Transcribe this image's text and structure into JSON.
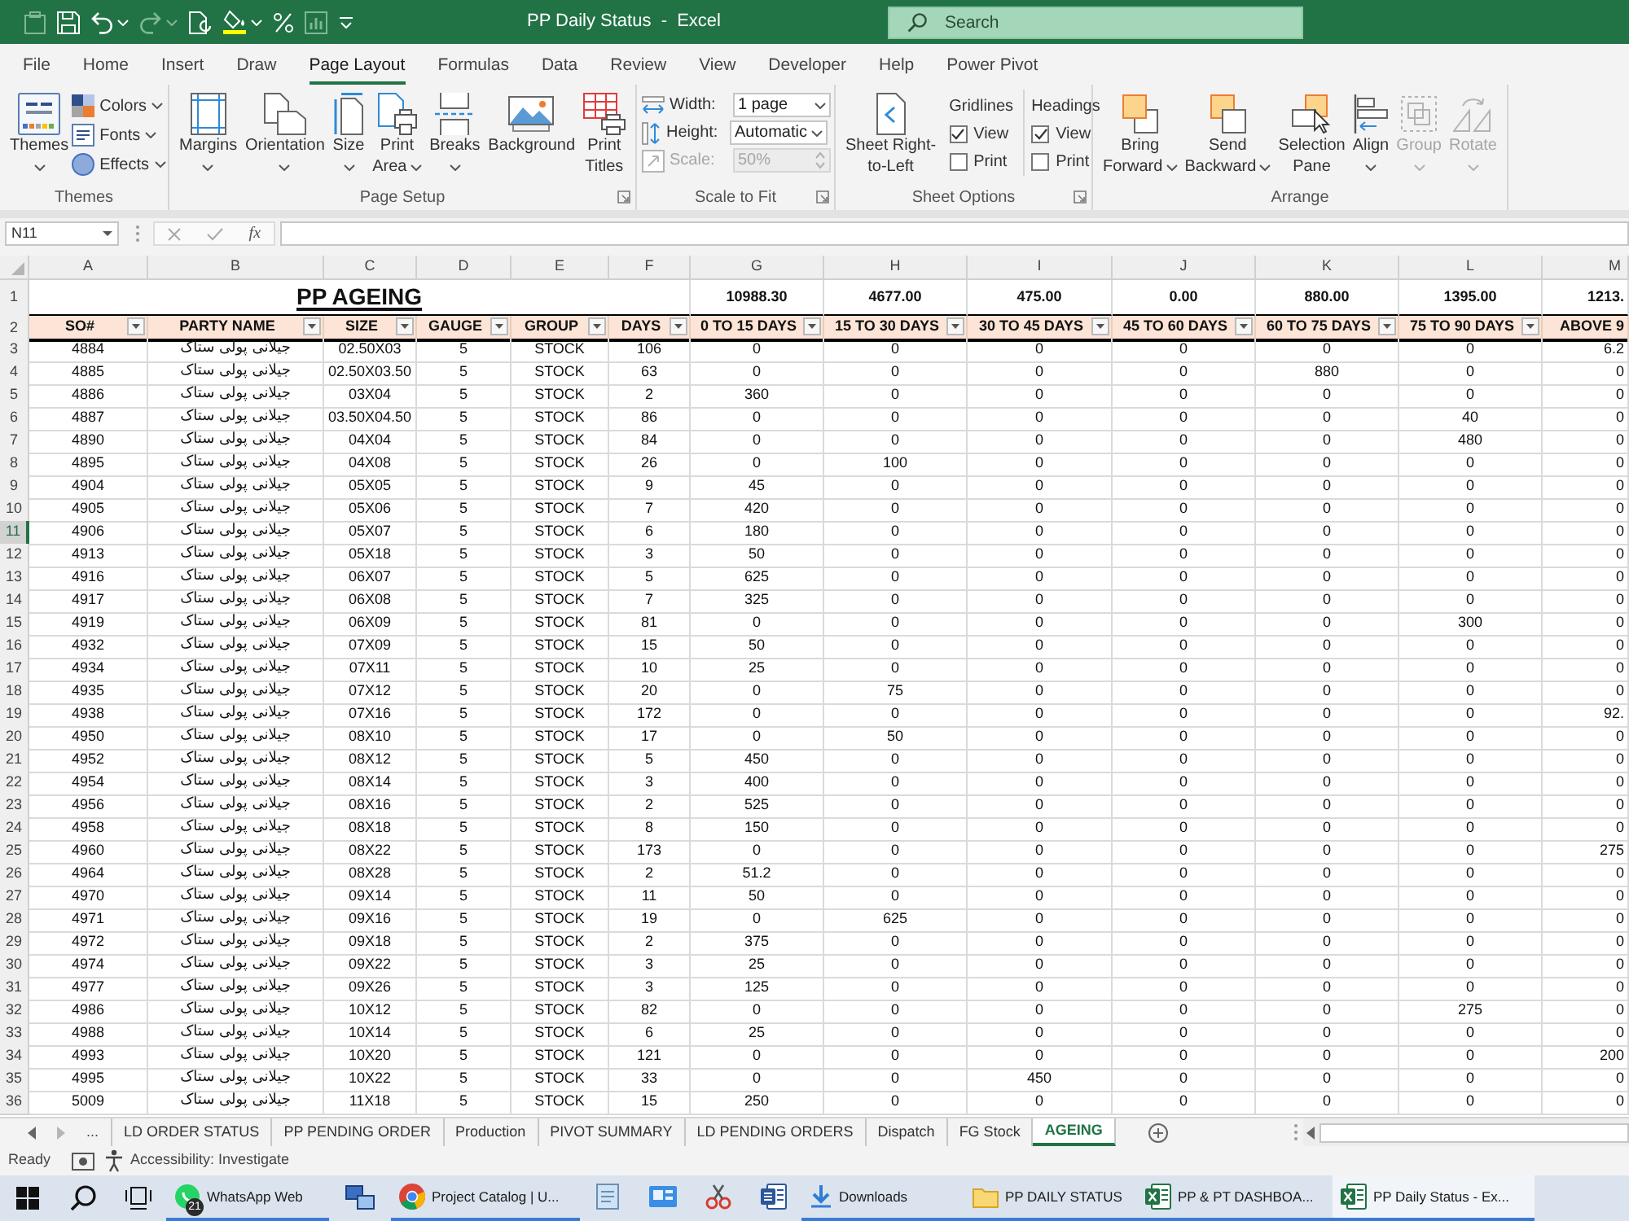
{
  "title_bar": {
    "title": "PP Daily Status  -  Excel",
    "search_placeholder": "Search",
    "quick_access": [
      {
        "disabled": true,
        "menu": false
      },
      {
        "disabled": false,
        "menu": false
      },
      {
        "disabled": false,
        "menu": true
      },
      {
        "disabled": true,
        "menu": true
      },
      {
        "disabled": false,
        "menu": false
      },
      {
        "disabled": false,
        "menu": true
      },
      {
        "disabled": false,
        "menu": false
      },
      {
        "disabled": true,
        "menu": false
      },
      {
        "disabled": false,
        "menu": false
      }
    ]
  },
  "ribbon_tabs": [
    {
      "label": "File",
      "selected": false
    },
    {
      "label": "Home",
      "selected": false
    },
    {
      "label": "Insert",
      "selected": false
    },
    {
      "label": "Draw",
      "selected": false
    },
    {
      "label": "Page Layout",
      "selected": true
    },
    {
      "label": "Formulas",
      "selected": false
    },
    {
      "label": "Data",
      "selected": false
    },
    {
      "label": "Review",
      "selected": false
    },
    {
      "label": "View",
      "selected": false
    },
    {
      "label": "Developer",
      "selected": false
    },
    {
      "label": "Help",
      "selected": false
    },
    {
      "label": "Power Pivot",
      "selected": false
    }
  ],
  "ribbon": {
    "groups": [
      {
        "label": "Themes",
        "launcher": false,
        "items": [
          {
            "kind": "large",
            "lines": [
              "Themes"
            ],
            "menu": true,
            "disabled": false
          },
          {
            "kind": "small",
            "label": "Colors",
            "menu": true,
            "disabled": false
          },
          {
            "kind": "small",
            "label": "Fonts",
            "menu": true,
            "disabled": false
          },
          {
            "kind": "small",
            "label": "Effects",
            "menu": true,
            "disabled": false
          }
        ]
      },
      {
        "label": "Page Setup",
        "launcher": true,
        "items": [
          {
            "kind": "large",
            "lines": [
              "Margins"
            ],
            "menu": true,
            "disabled": false
          },
          {
            "kind": "large",
            "lines": [
              "Orientation"
            ],
            "menu": true,
            "disabled": false
          },
          {
            "kind": "large",
            "lines": [
              "Size"
            ],
            "menu": true,
            "disabled": false
          },
          {
            "kind": "large",
            "lines": [
              "Print",
              "Area"
            ],
            "menu": true,
            "disabled": false
          },
          {
            "kind": "large",
            "lines": [
              "Breaks"
            ],
            "menu": true,
            "disabled": false
          },
          {
            "kind": "large",
            "lines": [
              "Background"
            ],
            "menu": false,
            "disabled": false
          },
          {
            "kind": "large",
            "lines": [
              "Print",
              "Titles"
            ],
            "menu": false,
            "disabled": false
          }
        ]
      },
      {
        "label": "Scale to Fit",
        "launcher": true,
        "items": [
          {
            "kind": "dropdown",
            "label": "Width:",
            "value": "1 page",
            "disabled": false
          },
          {
            "kind": "dropdown",
            "label": "Height:",
            "value": "Automatic",
            "disabled": false
          },
          {
            "kind": "spinner",
            "label": "Scale:",
            "value": "50%",
            "disabled": true
          }
        ]
      },
      {
        "label": "Sheet Options",
        "launcher": true,
        "items": [
          {
            "kind": "large",
            "lines": [
              "Sheet Right-",
              "to-Left"
            ],
            "menu": false,
            "disabled": false
          },
          {
            "kind": "checks",
            "heading": "Gridlines",
            "options": [
              {
                "label": "View",
                "checked": true
              },
              {
                "label": "Print",
                "checked": false
              }
            ]
          },
          {
            "kind": "checks",
            "heading": "Headings",
            "options": [
              {
                "label": "View",
                "checked": true
              },
              {
                "label": "Print",
                "checked": false
              }
            ]
          }
        ]
      },
      {
        "label": "Arrange",
        "launcher": false,
        "items": [
          {
            "kind": "large",
            "lines": [
              "Bring",
              "Forward"
            ],
            "menu": true,
            "disabled": false
          },
          {
            "kind": "large",
            "lines": [
              "Send",
              "Backward"
            ],
            "menu": true,
            "disabled": false
          },
          {
            "kind": "large",
            "lines": [
              "Selection",
              "Pane"
            ],
            "menu": false,
            "disabled": false
          },
          {
            "kind": "large",
            "lines": [
              "Align"
            ],
            "menu": true,
            "disabled": false
          },
          {
            "kind": "large",
            "lines": [
              "Group"
            ],
            "menu": true,
            "disabled": true
          },
          {
            "kind": "large",
            "lines": [
              "Rotate"
            ],
            "menu": true,
            "disabled": true
          }
        ]
      }
    ]
  },
  "formula_bar": {
    "name_box": "N11",
    "function_label": "fx"
  },
  "sheet": {
    "columns": [
      {
        "letter": "A",
        "header": "SO#",
        "filter": true
      },
      {
        "letter": "B",
        "header": "PARTY NAME",
        "filter": true
      },
      {
        "letter": "C",
        "header": "SIZE",
        "filter": true
      },
      {
        "letter": "D",
        "header": "GAUGE",
        "filter": true
      },
      {
        "letter": "E",
        "header": "GROUP",
        "filter": true
      },
      {
        "letter": "F",
        "header": "DAYS",
        "filter": true
      },
      {
        "letter": "G",
        "header": "0 TO 15 DAYS",
        "filter": true
      },
      {
        "letter": "H",
        "header": "15 TO 30 DAYS",
        "filter": true
      },
      {
        "letter": "I",
        "header": "30 TO 45 DAYS",
        "filter": true
      },
      {
        "letter": "J",
        "header": "45 TO 60 DAYS",
        "filter": true
      },
      {
        "letter": "K",
        "header": "60 TO 75 DAYS",
        "filter": true
      },
      {
        "letter": "L",
        "header": "75 TO 90 DAYS",
        "filter": true
      },
      {
        "letter": "M",
        "header": "ABOVE 9",
        "filter": false
      }
    ],
    "title_row": {
      "number": "1",
      "title": "PP AGEING",
      "totals": [
        "10988.30",
        "4677.00",
        "475.00",
        "0.00",
        "880.00",
        "1395.00",
        "1213."
      ]
    },
    "header_row": {
      "number": "2"
    },
    "rows": [
      {
        "number": "3",
        "selected": false,
        "cells": [
          "4884",
          "جیلانی پولی ستاک",
          "02.50X03",
          "5",
          "STOCK",
          "106",
          "0",
          "0",
          "0",
          "0",
          "0",
          "0",
          "6.2"
        ]
      },
      {
        "number": "4",
        "selected": false,
        "cells": [
          "4885",
          "جیلانی پولی ستاک",
          "02.50X03.50",
          "5",
          "STOCK",
          "63",
          "0",
          "0",
          "0",
          "0",
          "880",
          "0",
          "0"
        ]
      },
      {
        "number": "5",
        "selected": false,
        "cells": [
          "4886",
          "جیلانی پولی ستاک",
          "03X04",
          "5",
          "STOCK",
          "2",
          "360",
          "0",
          "0",
          "0",
          "0",
          "0",
          "0"
        ]
      },
      {
        "number": "6",
        "selected": false,
        "cells": [
          "4887",
          "جیلانی پولی ستاک",
          "03.50X04.50",
          "5",
          "STOCK",
          "86",
          "0",
          "0",
          "0",
          "0",
          "0",
          "40",
          "0"
        ]
      },
      {
        "number": "7",
        "selected": false,
        "cells": [
          "4890",
          "جیلانی پولی ستاک",
          "04X04",
          "5",
          "STOCK",
          "84",
          "0",
          "0",
          "0",
          "0",
          "0",
          "480",
          "0"
        ]
      },
      {
        "number": "8",
        "selected": false,
        "cells": [
          "4895",
          "جیلانی پولی ستاک",
          "04X08",
          "5",
          "STOCK",
          "26",
          "0",
          "100",
          "0",
          "0",
          "0",
          "0",
          "0"
        ]
      },
      {
        "number": "9",
        "selected": false,
        "cells": [
          "4904",
          "جیلانی پولی ستاک",
          "05X05",
          "5",
          "STOCK",
          "9",
          "45",
          "0",
          "0",
          "0",
          "0",
          "0",
          "0"
        ]
      },
      {
        "number": "10",
        "selected": false,
        "cells": [
          "4905",
          "جیلانی پولی ستاک",
          "05X06",
          "5",
          "STOCK",
          "7",
          "420",
          "0",
          "0",
          "0",
          "0",
          "0",
          "0"
        ]
      },
      {
        "number": "11",
        "selected": true,
        "cells": [
          "4906",
          "جیلانی پولی ستاک",
          "05X07",
          "5",
          "STOCK",
          "6",
          "180",
          "0",
          "0",
          "0",
          "0",
          "0",
          "0"
        ]
      },
      {
        "number": "12",
        "selected": false,
        "cells": [
          "4913",
          "جیلانی پولی ستاک",
          "05X18",
          "5",
          "STOCK",
          "3",
          "50",
          "0",
          "0",
          "0",
          "0",
          "0",
          "0"
        ]
      },
      {
        "number": "13",
        "selected": false,
        "cells": [
          "4916",
          "جیلانی پولی ستاک",
          "06X07",
          "5",
          "STOCK",
          "5",
          "625",
          "0",
          "0",
          "0",
          "0",
          "0",
          "0"
        ]
      },
      {
        "number": "14",
        "selected": false,
        "cells": [
          "4917",
          "جیلانی پولی ستاک",
          "06X08",
          "5",
          "STOCK",
          "7",
          "325",
          "0",
          "0",
          "0",
          "0",
          "0",
          "0"
        ]
      },
      {
        "number": "15",
        "selected": false,
        "cells": [
          "4919",
          "جیلانی پولی ستاک",
          "06X09",
          "5",
          "STOCK",
          "81",
          "0",
          "0",
          "0",
          "0",
          "0",
          "300",
          "0"
        ]
      },
      {
        "number": "16",
        "selected": false,
        "cells": [
          "4932",
          "جیلانی پولی ستاک",
          "07X09",
          "5",
          "STOCK",
          "15",
          "50",
          "0",
          "0",
          "0",
          "0",
          "0",
          "0"
        ]
      },
      {
        "number": "17",
        "selected": false,
        "cells": [
          "4934",
          "جیلانی پولی ستاک",
          "07X11",
          "5",
          "STOCK",
          "10",
          "25",
          "0",
          "0",
          "0",
          "0",
          "0",
          "0"
        ]
      },
      {
        "number": "18",
        "selected": false,
        "cells": [
          "4935",
          "جیلانی پولی ستاک",
          "07X12",
          "5",
          "STOCK",
          "20",
          "0",
          "75",
          "0",
          "0",
          "0",
          "0",
          "0"
        ]
      },
      {
        "number": "19",
        "selected": false,
        "cells": [
          "4938",
          "جیلانی پولی ستاک",
          "07X16",
          "5",
          "STOCK",
          "172",
          "0",
          "0",
          "0",
          "0",
          "0",
          "0",
          "92."
        ]
      },
      {
        "number": "20",
        "selected": false,
        "cells": [
          "4950",
          "جیلانی پولی ستاک",
          "08X10",
          "5",
          "STOCK",
          "17",
          "0",
          "50",
          "0",
          "0",
          "0",
          "0",
          "0"
        ]
      },
      {
        "number": "21",
        "selected": false,
        "cells": [
          "4952",
          "جیلانی پولی ستاک",
          "08X12",
          "5",
          "STOCK",
          "5",
          "450",
          "0",
          "0",
          "0",
          "0",
          "0",
          "0"
        ]
      },
      {
        "number": "22",
        "selected": false,
        "cells": [
          "4954",
          "جیلانی پولی ستاک",
          "08X14",
          "5",
          "STOCK",
          "3",
          "400",
          "0",
          "0",
          "0",
          "0",
          "0",
          "0"
        ]
      },
      {
        "number": "23",
        "selected": false,
        "cells": [
          "4956",
          "جیلانی پولی ستاک",
          "08X16",
          "5",
          "STOCK",
          "2",
          "525",
          "0",
          "0",
          "0",
          "0",
          "0",
          "0"
        ]
      },
      {
        "number": "24",
        "selected": false,
        "cells": [
          "4958",
          "جیلانی پولی ستاک",
          "08X18",
          "5",
          "STOCK",
          "8",
          "150",
          "0",
          "0",
          "0",
          "0",
          "0",
          "0"
        ]
      },
      {
        "number": "25",
        "selected": false,
        "cells": [
          "4960",
          "جیلانی پولی ستاک",
          "08X22",
          "5",
          "STOCK",
          "173",
          "0",
          "0",
          "0",
          "0",
          "0",
          "0",
          "275"
        ]
      },
      {
        "number": "26",
        "selected": false,
        "cells": [
          "4964",
          "جیلانی پولی ستاک",
          "08X28",
          "5",
          "STOCK",
          "2",
          "51.2",
          "0",
          "0",
          "0",
          "0",
          "0",
          "0"
        ]
      },
      {
        "number": "27",
        "selected": false,
        "cells": [
          "4970",
          "جیلانی پولی ستاک",
          "09X14",
          "5",
          "STOCK",
          "11",
          "50",
          "0",
          "0",
          "0",
          "0",
          "0",
          "0"
        ]
      },
      {
        "number": "28",
        "selected": false,
        "cells": [
          "4971",
          "جیلانی پولی ستاک",
          "09X16",
          "5",
          "STOCK",
          "19",
          "0",
          "625",
          "0",
          "0",
          "0",
          "0",
          "0"
        ]
      },
      {
        "number": "29",
        "selected": false,
        "cells": [
          "4972",
          "جیلانی پولی ستاک",
          "09X18",
          "5",
          "STOCK",
          "2",
          "375",
          "0",
          "0",
          "0",
          "0",
          "0",
          "0"
        ]
      },
      {
        "number": "30",
        "selected": false,
        "cells": [
          "4974",
          "جیلانی پولی ستاک",
          "09X22",
          "5",
          "STOCK",
          "3",
          "25",
          "0",
          "0",
          "0",
          "0",
          "0",
          "0"
        ]
      },
      {
        "number": "31",
        "selected": false,
        "cells": [
          "4977",
          "جیلانی پولی ستاک",
          "09X26",
          "5",
          "STOCK",
          "3",
          "125",
          "0",
          "0",
          "0",
          "0",
          "0",
          "0"
        ]
      },
      {
        "number": "32",
        "selected": false,
        "cells": [
          "4986",
          "جیلانی پولی ستاک",
          "10X12",
          "5",
          "STOCK",
          "82",
          "0",
          "0",
          "0",
          "0",
          "0",
          "275",
          "0"
        ]
      },
      {
        "number": "33",
        "selected": false,
        "cells": [
          "4988",
          "جیلانی پولی ستاک",
          "10X14",
          "5",
          "STOCK",
          "6",
          "25",
          "0",
          "0",
          "0",
          "0",
          "0",
          "0"
        ]
      },
      {
        "number": "34",
        "selected": false,
        "cells": [
          "4993",
          "جیلانی پولی ستاک",
          "10X20",
          "5",
          "STOCK",
          "121",
          "0",
          "0",
          "0",
          "0",
          "0",
          "0",
          "200"
        ]
      },
      {
        "number": "35",
        "selected": false,
        "cells": [
          "4995",
          "جیلانی پولی ستاک",
          "10X22",
          "5",
          "STOCK",
          "33",
          "0",
          "0",
          "450",
          "0",
          "0",
          "0",
          "0"
        ]
      },
      {
        "number": "36",
        "selected": false,
        "cells": [
          "5009",
          "جیلانی پولی ستاک",
          "11X18",
          "5",
          "STOCK",
          "15",
          "250",
          "0",
          "0",
          "0",
          "0",
          "0",
          "0"
        ]
      }
    ]
  },
  "sheet_tabs": {
    "overflow_label": "...",
    "tabs": [
      {
        "label": "LD ORDER STATUS",
        "selected": false
      },
      {
        "label": "PP PENDING ORDER",
        "selected": false
      },
      {
        "label": "Production",
        "selected": false
      },
      {
        "label": "PIVOT SUMMARY",
        "selected": false
      },
      {
        "label": "LD PENDING ORDERS",
        "selected": false
      },
      {
        "label": "Dispatch",
        "selected": false
      },
      {
        "label": "FG Stock",
        "selected": false
      },
      {
        "label": "AGEING",
        "selected": true
      }
    ]
  },
  "status_bar": {
    "status": "Ready",
    "accessibility": "Accessibility: Investigate"
  },
  "taskbar": {
    "items": [
      {
        "label": "WhatsApp Web",
        "badge": "21",
        "running": true,
        "selected": false
      },
      {
        "running": false,
        "selected": false
      },
      {
        "label": "Project Catalog | U...",
        "running": true,
        "selected": false
      },
      {
        "running": false,
        "selected": false
      },
      {
        "running": false,
        "selected": false
      },
      {
        "running": false,
        "selected": false
      },
      {
        "running": false,
        "selected": false
      },
      {
        "label": "Downloads",
        "running": true,
        "selected": false
      },
      {
        "label": "PP DAILY STATUS",
        "running": true,
        "selected": false
      },
      {
        "label": "PP & PT DASHBOA...",
        "running": true,
        "selected": false
      },
      {
        "label": "PP Daily Status - Ex...",
        "running": true,
        "selected": true
      }
    ]
  }
}
